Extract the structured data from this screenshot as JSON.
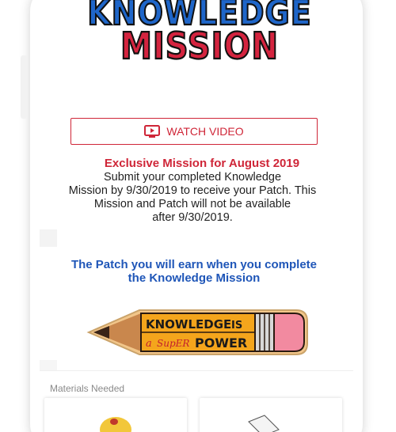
{
  "header": {
    "logo_line1": "KNOWLEDGE",
    "logo_line2": "MISSION"
  },
  "watch_video": {
    "label": "WATCH VIDEO",
    "icon": "play-video-icon",
    "color": "#cf2638"
  },
  "mission": {
    "title": "Exclusive Mission for August 2019",
    "description_lines": [
      "Submit your completed Knowledge",
      "Mission by 9/30/2019 to receive your Patch. This",
      "Mission and Patch will not be available",
      "after 9/30/2019."
    ]
  },
  "patch": {
    "title_lines": [
      "The Patch you will earn when you complete",
      "the Knowledge Mission"
    ],
    "pencil_text_top": "KNOWLEDGE",
    "pencil_text_is": "IS",
    "pencil_text_a": "a",
    "pencil_text_super": "SupER",
    "pencil_text_power": "POWER"
  },
  "materials": {
    "label": "Materials Needed"
  },
  "colors": {
    "accent_red": "#cf2638",
    "accent_blue": "#1f56b8"
  }
}
